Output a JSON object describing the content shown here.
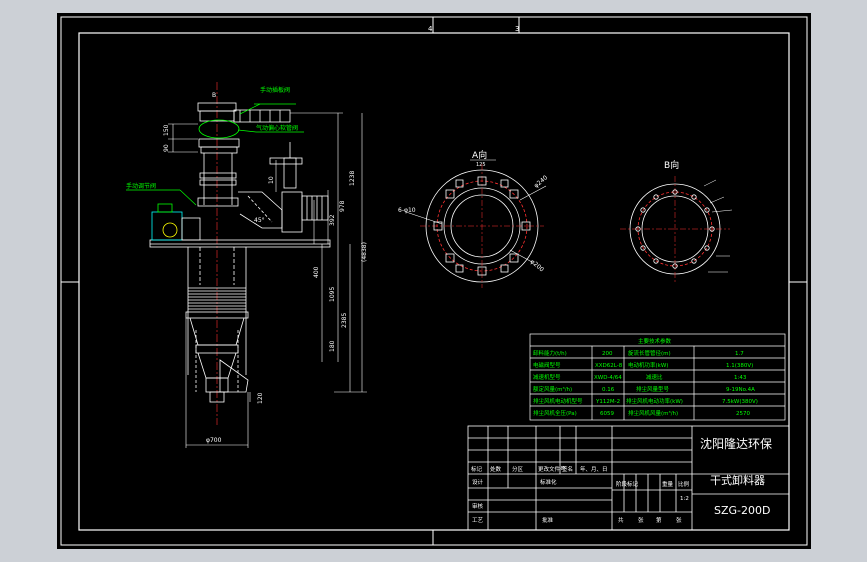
{
  "colors": {
    "app_background": "#ccd0d6",
    "canvas": "#000000",
    "line": "#ffffff",
    "dimension": "#ffffff",
    "annotation": "#00ff00",
    "hidden_line": "#ff3030",
    "accent": "#ffff00",
    "component_highlight": "#00ffff"
  },
  "sheet": {
    "zone_marks": [
      "4",
      "3"
    ]
  },
  "views": {
    "section_a_label": "A向",
    "section_b_label": "B向",
    "section_b_marker": "B"
  },
  "callouts": {
    "hand_valve": "手动插板阀",
    "pneumatic_valve": "气动偏心软管阀",
    "hand_adjust_valve": "手动调节阀"
  },
  "dimensions": {
    "d_90": "90",
    "d_150": "150",
    "d_10": "10",
    "d_45deg": "45°",
    "d_1238": "1238",
    "d_978": "978",
    "d_4838": "(4838)",
    "d_392": "392",
    "d_400": "400",
    "d_1095": "1095",
    "d_2385": "2385",
    "d_180": "180",
    "d_120": "120",
    "d_phi700": "φ700",
    "a_phi240": "φ240",
    "a_phi200": "φ200",
    "a_holes": "6-φ10",
    "a_top": "125"
  },
  "params_table": {
    "title": "主要技术参数",
    "rows": [
      [
        "卸料能力(t/h)",
        "200",
        "旋流长管管径(m)",
        "1.7"
      ],
      [
        "电磁阀型号",
        "XXD62L-8",
        "电动机功率(kW)",
        "1.1(380V)"
      ],
      [
        "减速机型号",
        "XWD-4/64",
        "减速比",
        "1:43"
      ],
      [
        "额定风量(m³/h)",
        "0.16",
        "排尘风量型号",
        "9-19No.4A"
      ],
      [
        "排尘风机电动机型号",
        "Y112M-2",
        "排尘风机电动功率(kW)",
        "7.5kW(380V)"
      ],
      [
        "排尘风机全压(Pa)",
        "6059",
        "排尘风机风量(m³/h)",
        "2570"
      ]
    ]
  },
  "title_block": {
    "company": "沈阳隆达环保",
    "drawing_name": "干式卸料器",
    "drawing_no": "SZG-200D",
    "header_row": [
      "标记",
      "处数",
      "分区",
      "更改文件号",
      "签名",
      "年、月、日"
    ],
    "row_design": "设计",
    "row_standard": "标准化",
    "row_check": "审核",
    "row_process": "工艺",
    "row_approve": "批准",
    "stage_headers": [
      "阶段标记",
      "重量",
      "比例"
    ],
    "scale": "1:2",
    "sheet_count": [
      "共",
      "张",
      "第",
      "张"
    ]
  }
}
